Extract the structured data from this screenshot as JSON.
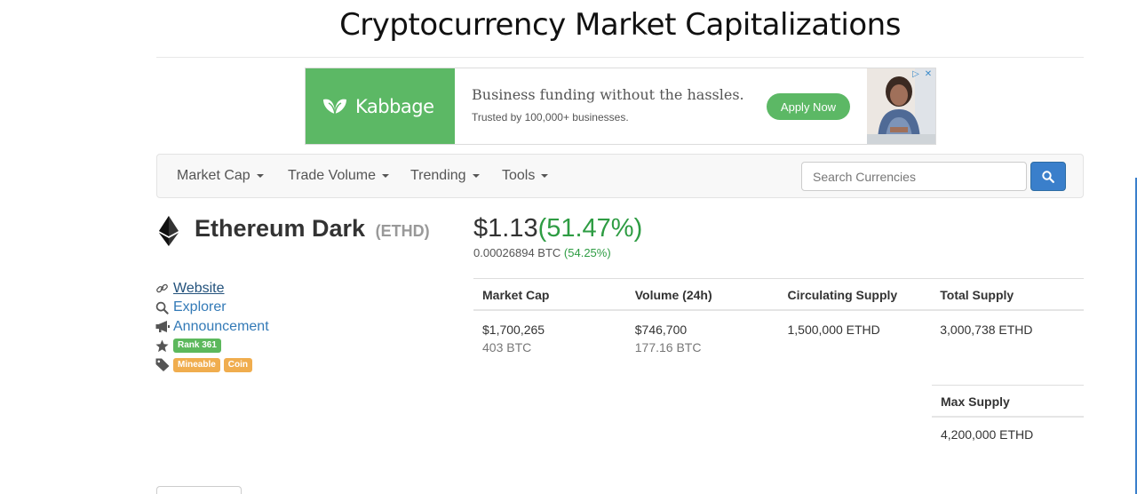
{
  "page": {
    "title": "Cryptocurrency Market Capitalizations"
  },
  "ad": {
    "brand": "Kabbage",
    "headline": "Business funding without the hassles.",
    "subline": "Trusted by 100,000+ businesses.",
    "cta": "Apply Now",
    "brand_color": "#5cb865"
  },
  "nav": {
    "items": [
      {
        "label": "Market Cap"
      },
      {
        "label": "Trade Volume"
      },
      {
        "label": "Trending"
      },
      {
        "label": "Tools"
      }
    ],
    "search_placeholder": "Search Currencies"
  },
  "coin": {
    "name": "Ethereum Dark",
    "symbol": "(ETHD)",
    "price_usd": "$1.13",
    "change_usd": "(51.47%)",
    "price_btc": "0.00026894 BTC",
    "change_btc": "(54.25%)",
    "change_color": "#2e9c43"
  },
  "links": {
    "website": "Website",
    "explorer": "Explorer",
    "announcement": "Announcement",
    "rank": "Rank 361",
    "tags": [
      "Mineable",
      "Coin"
    ]
  },
  "stats": {
    "headers": [
      "Market Cap",
      "Volume (24h)",
      "Circulating Supply",
      "Total Supply"
    ],
    "market_cap": {
      "usd": "$1,700,265",
      "btc": "403 BTC"
    },
    "volume": {
      "usd": "$746,700",
      "btc": "177.16 BTC"
    },
    "circulating_supply": "1,500,000 ETHD",
    "total_supply": "3,000,738 ETHD",
    "max_supply_header": "Max Supply",
    "max_supply": "4,200,000 ETHD"
  }
}
